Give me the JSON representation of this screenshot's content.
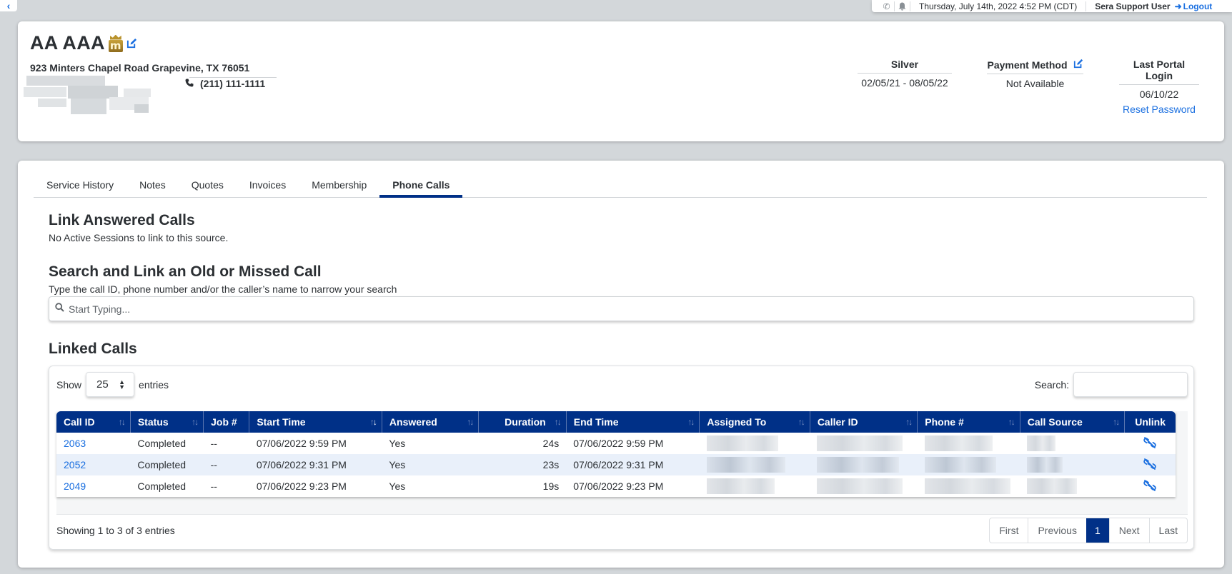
{
  "topbar": {
    "back_icon": "chevron-left-icon",
    "phone_icon": "phone-icon",
    "bell_icon": "bell-icon",
    "datetime": "Thursday, July 14th, 2022 4:52 PM (CDT)",
    "user": "Sera Support User",
    "logout_label": "Logout"
  },
  "customer": {
    "name": "AA AAA",
    "membership_badge": "m",
    "address": "923 Minters Chapel Road Grapevine, TX 76051",
    "phone": "(211) 111-1111"
  },
  "stats": {
    "membership": {
      "label": "Silver",
      "value": "02/05/21 - 08/05/22"
    },
    "payment": {
      "label": "Payment Method",
      "value": "Not Available"
    },
    "login": {
      "label": "Last Portal Login",
      "value": "06/10/22",
      "link": "Reset Password"
    }
  },
  "tabs": [
    {
      "label": "Service History",
      "active": false
    },
    {
      "label": "Notes",
      "active": false
    },
    {
      "label": "Quotes",
      "active": false
    },
    {
      "label": "Invoices",
      "active": false
    },
    {
      "label": "Membership",
      "active": false
    },
    {
      "label": "Phone Calls",
      "active": true
    }
  ],
  "link_answered": {
    "title": "Link Answered Calls",
    "message": "No Active Sessions to link to this source."
  },
  "search_link": {
    "title": "Search and Link an Old or Missed Call",
    "hint": "Type the call ID, phone number and/or the caller’s name to narrow your search",
    "placeholder": "Start Typing..."
  },
  "linked_calls": {
    "title": "Linked Calls",
    "show_label": "Show",
    "page_length": "25",
    "entries_label": "entries",
    "search_label": "Search:",
    "search_value": "",
    "columns": [
      "Call ID",
      "Status",
      "Job #",
      "Start Time",
      "Answered",
      "Duration",
      "End Time",
      "Assigned To",
      "Caller ID",
      "Phone #",
      "Call Source",
      "Unlink"
    ],
    "sorted_column": "Start Time",
    "sort_direction": "desc",
    "rows": [
      {
        "call_id": "2063",
        "status": "Completed",
        "job": "--",
        "start": "07/06/2022 9:59 PM",
        "answered": "Yes",
        "duration": "24s",
        "end": "07/06/2022 9:59 PM",
        "assigned_to": "[redacted]",
        "caller_id": "[redacted]",
        "phone": "[redacted]",
        "source": "[redacted]"
      },
      {
        "call_id": "2052",
        "status": "Completed",
        "job": "--",
        "start": "07/06/2022 9:31 PM",
        "answered": "Yes",
        "duration": "23s",
        "end": "07/06/2022 9:31 PM",
        "assigned_to": "[redacted]",
        "caller_id": "[redacted]",
        "phone": "[redacted]",
        "source": "[redacted]"
      },
      {
        "call_id": "2049",
        "status": "Completed",
        "job": "--",
        "start": "07/06/2022 9:23 PM",
        "answered": "Yes",
        "duration": "19s",
        "end": "07/06/2022 9:23 PM",
        "assigned_to": "[redacted]",
        "caller_id": "[redacted]",
        "phone": "[redacted]",
        "source": "[redacted]"
      }
    ],
    "info": "Showing 1 to 3 of 3 entries",
    "pagination": {
      "first": "First",
      "previous": "Previous",
      "current": "1",
      "next": "Next",
      "last": "Last"
    }
  },
  "colors": {
    "primary": "#003087",
    "link": "#1a6fe0",
    "row_alt": "#e9f0fa",
    "badge_gold": "#b8922c"
  }
}
